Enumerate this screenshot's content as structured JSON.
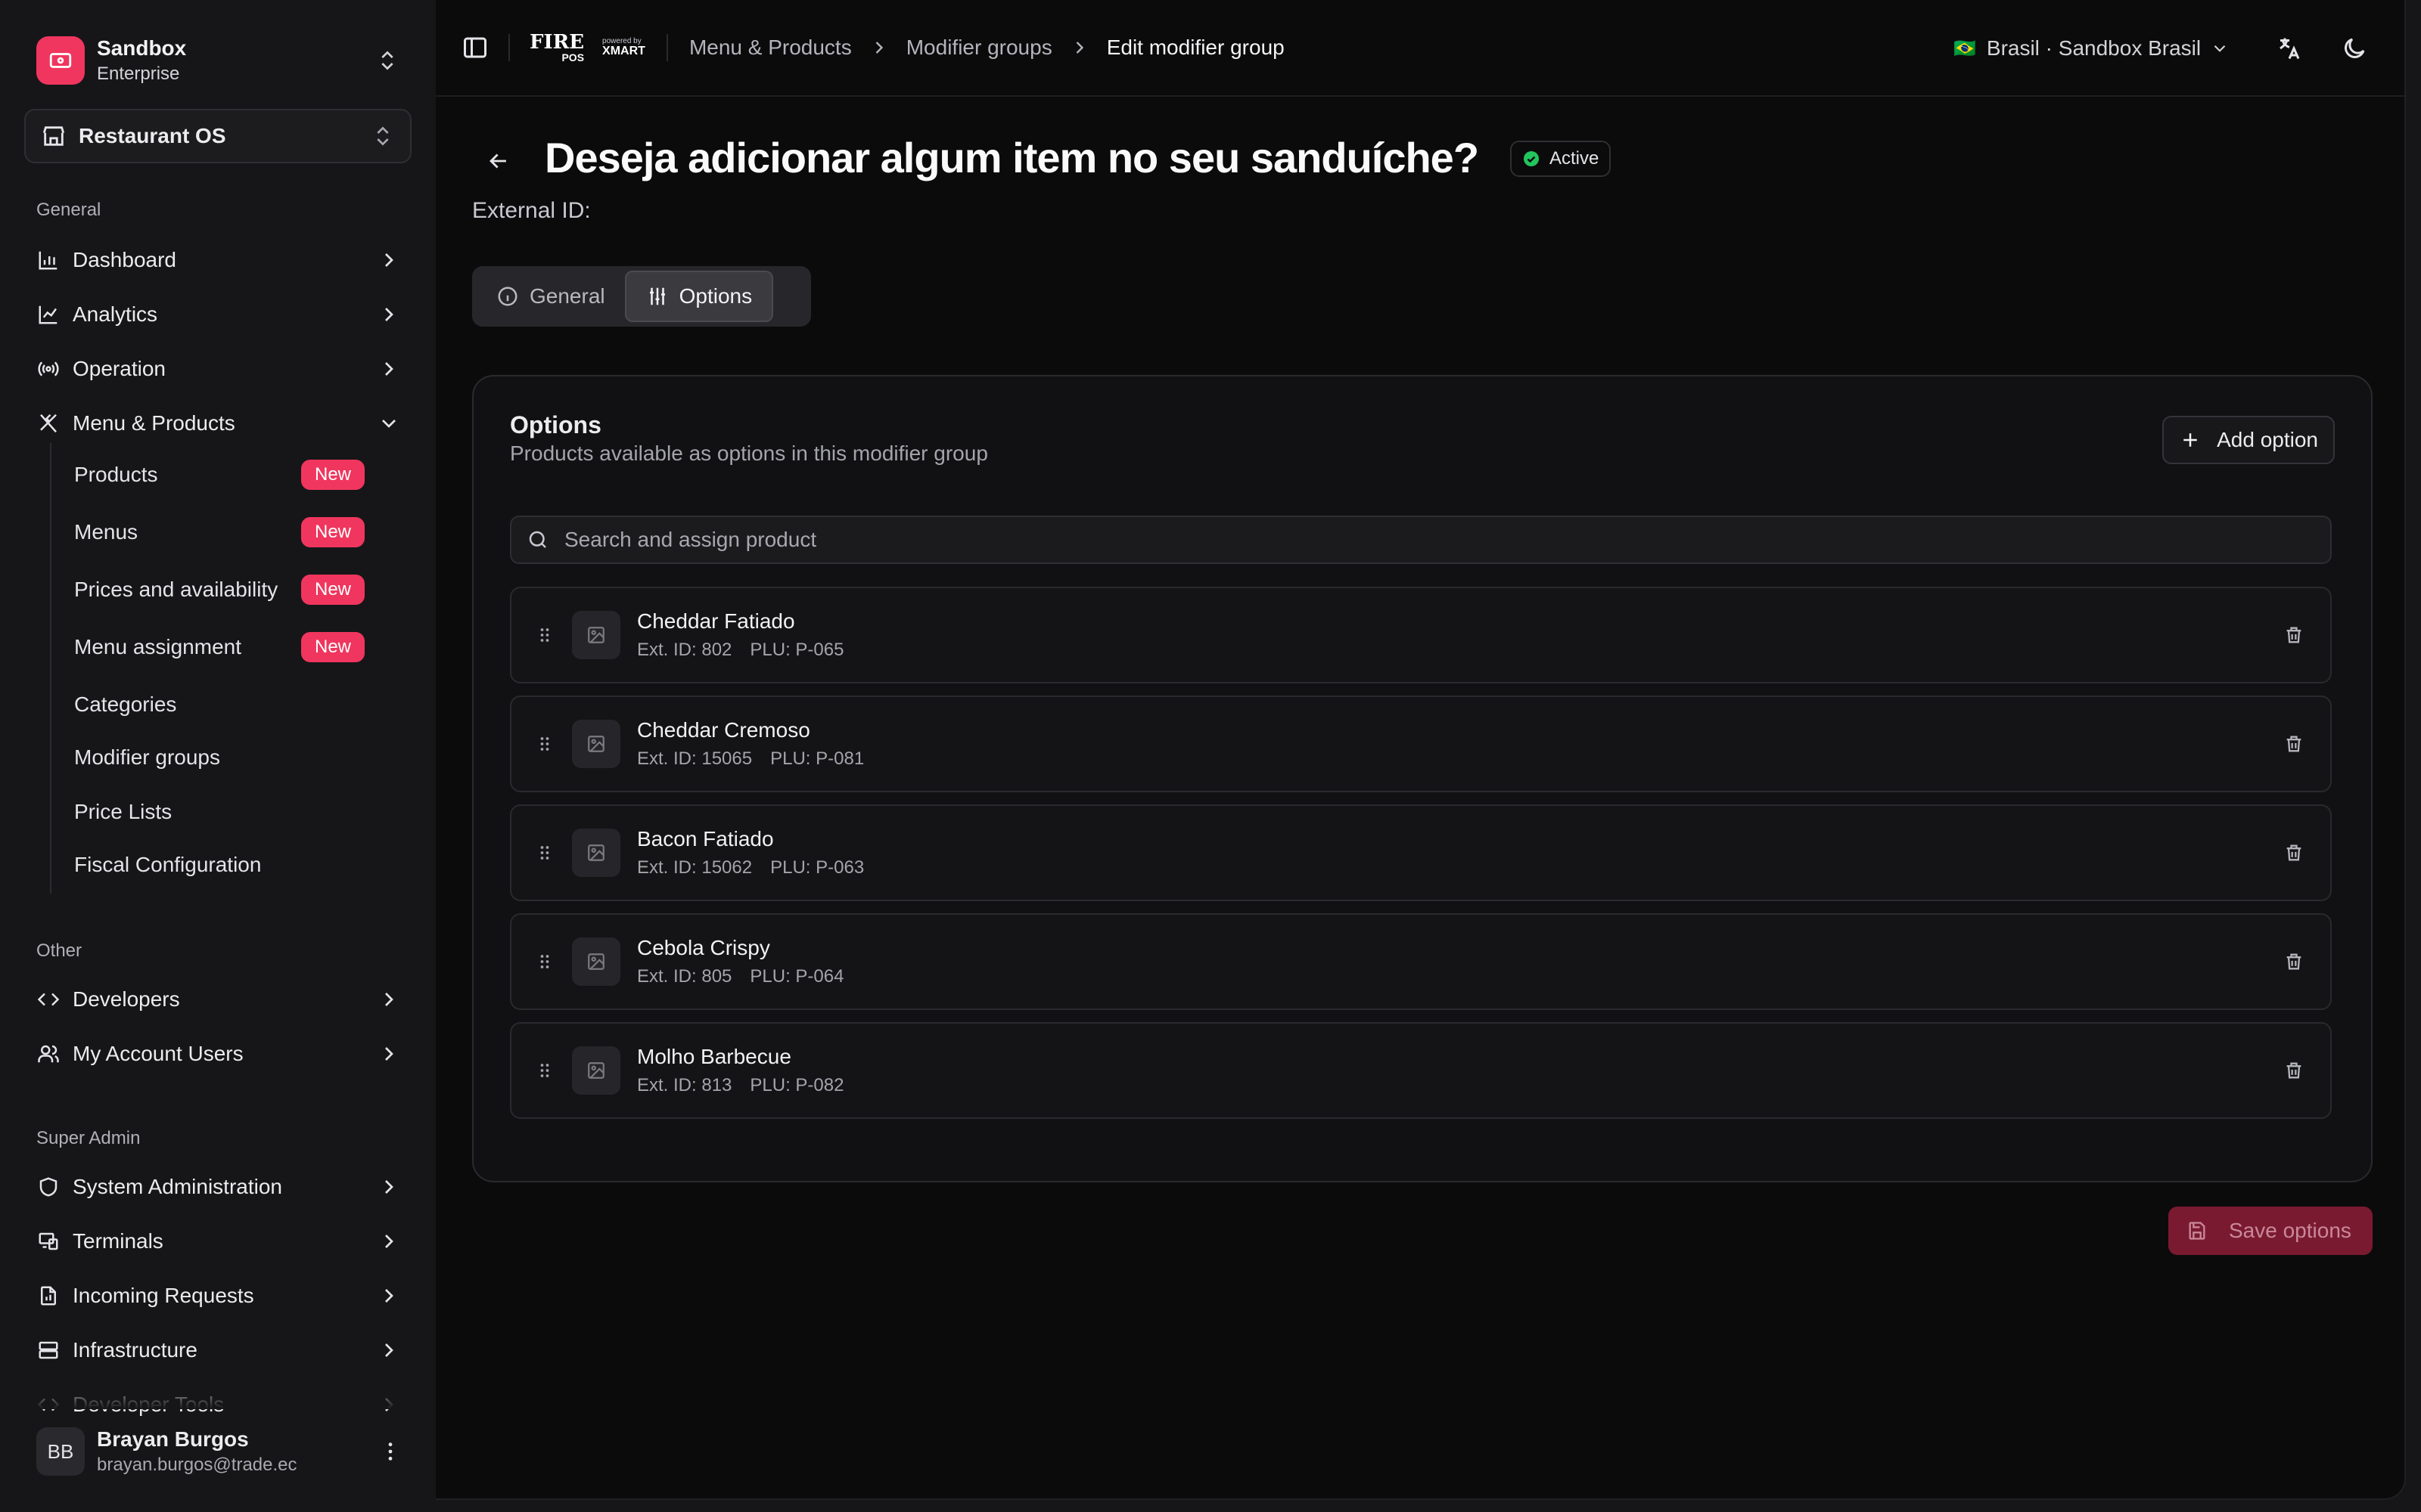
{
  "org": {
    "name": "Sandbox",
    "plan": "Enterprise"
  },
  "app": {
    "name": "Restaurant OS"
  },
  "sidebar": {
    "general_label": "General",
    "general": [
      {
        "label": "Dashboard",
        "icon": "bar-chart-icon"
      },
      {
        "label": "Analytics",
        "icon": "line-chart-icon"
      },
      {
        "label": "Operation",
        "icon": "radio-icon"
      },
      {
        "label": "Menu & Products",
        "icon": "utensils-icon"
      }
    ],
    "menu_sub": [
      {
        "label": "Products",
        "badge": "New"
      },
      {
        "label": "Menus",
        "badge": "New"
      },
      {
        "label": "Prices and availability",
        "badge": "New"
      },
      {
        "label": "Menu assignment",
        "badge": "New"
      },
      {
        "label": "Categories"
      },
      {
        "label": "Modifier groups"
      },
      {
        "label": "Price Lists"
      },
      {
        "label": "Fiscal Configuration"
      }
    ],
    "other_label": "Other",
    "other": [
      {
        "label": "Developers",
        "icon": "code-icon"
      },
      {
        "label": "My Account Users",
        "icon": "users-icon"
      }
    ],
    "super_label": "Super Admin",
    "super": [
      {
        "label": "System Administration",
        "icon": "shield-icon"
      },
      {
        "label": "Terminals",
        "icon": "terminal-icon"
      },
      {
        "label": "Incoming Requests",
        "icon": "file-icon"
      },
      {
        "label": "Infrastructure",
        "icon": "server-icon"
      },
      {
        "label": "Developer Tools",
        "icon": "code-icon"
      }
    ]
  },
  "user": {
    "initials": "BB",
    "name": "Brayan Burgos",
    "email": "brayan.burgos@trade.ec"
  },
  "header": {
    "logo_text": "FIRE",
    "logo_sub": "POS",
    "powered_by": "powered by",
    "powered_brand": "XMART",
    "breadcrumbs": [
      "Menu & Products",
      "Modifier groups",
      "Edit modifier group"
    ],
    "region": "Brasil · Sandbox Brasil",
    "region_flag": "🇧🇷"
  },
  "page": {
    "title": "Deseja adicionar algum item no seu sanduíche?",
    "status": "Active",
    "status_color": "#22c55e",
    "external_id_label": "External ID:",
    "tabs": [
      "General",
      "Options"
    ],
    "active_tab": "Options"
  },
  "options_card": {
    "title": "Options",
    "subtitle": "Products available as options in this modifier group",
    "add_label": "Add option",
    "search_placeholder": "Search and assign product",
    "items": [
      {
        "name": "Cheddar Fatiado",
        "ext": "Ext. ID: 802",
        "plu": "PLU: P-065"
      },
      {
        "name": "Cheddar Cremoso",
        "ext": "Ext. ID: 15065",
        "plu": "PLU: P-081"
      },
      {
        "name": "Bacon Fatiado",
        "ext": "Ext. ID: 15062",
        "plu": "PLU: P-063"
      },
      {
        "name": "Cebola Crispy",
        "ext": "Ext. ID: 805",
        "plu": "PLU: P-064"
      },
      {
        "name": "Molho Barbecue",
        "ext": "Ext. ID: 813",
        "plu": "PLU: P-082"
      }
    ]
  },
  "save_label": "Save options",
  "colors": {
    "accent": "#f0365e",
    "background": "#0b0b0c",
    "sidebar": "#161618"
  }
}
